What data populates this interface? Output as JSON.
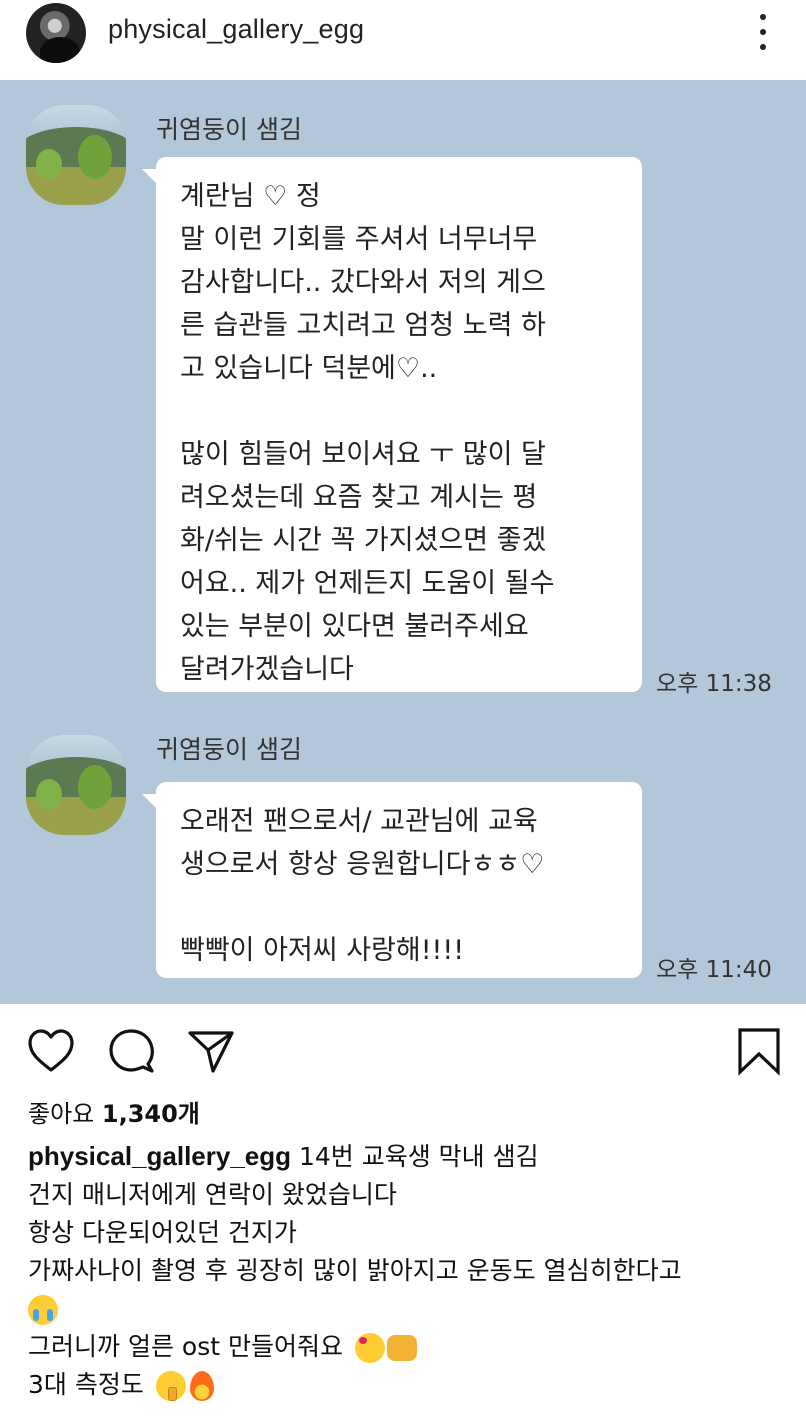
{
  "header": {
    "username": "physical_gallery_egg"
  },
  "chat": {
    "messages": [
      {
        "sender": "귀염둥이 샘김",
        "text": "계란님                         ♡ 정\n말 이런 기회를 주셔서 너무너무\n감사합니다.. 갔다와서 저의 게으\n른 습관들 고치려고 엄청 노력 하\n고 있습니다 덕분에♡..\n\n많이 힘들어 보이셔요 ㅜ 많이 달\n려오셨는데 요즘 찾고 계시는 평\n화/쉬는 시간 꼭 가지셨으면 좋겠\n어요.. 제가 언제든지 도움이 될수\n있는 부분이 있다면 불러주세요\n달려가겠습니다",
        "time": "오후 11:38"
      },
      {
        "sender": "귀염둥이 샘김",
        "text": "오래전 팬으로서/ 교관님에 교육\n생으로서 항상 응원합니다ㅎㅎ♡\n\n빡빡이 아저씨 사랑해!!!!",
        "time": "오후 11:40"
      }
    ]
  },
  "actions": {
    "icons": [
      "heart-icon",
      "comment-icon",
      "share-icon",
      "bookmark-icon"
    ]
  },
  "likes": {
    "label": "좋아요",
    "count": "1,340개"
  },
  "caption": {
    "username": "physical_gallery_egg",
    "line1": " 14번 교육생 막내 샘김",
    "line2": "건지 매니저에게 연락이 왔었습니다",
    "line3": "항상 다운되어있던 건지가",
    "line4": "가짜사나이 촬영 후 굉장히 많이 밝아지고 운동도 열심히한다고",
    "line6": "그러니까 얼른 ost 만들어줘요 ",
    "line7": "3대 측정도 "
  }
}
